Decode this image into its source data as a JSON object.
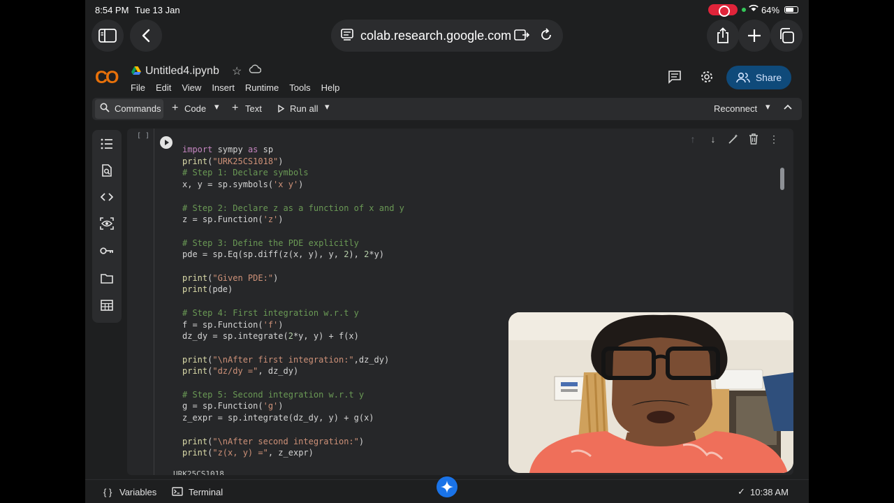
{
  "status": {
    "time": "8:54 PM",
    "date": "Tue 13 Jan",
    "battery": "64%"
  },
  "browser": {
    "url": "colab.research.google.com"
  },
  "colab": {
    "logo": "CO",
    "title": "Untitled4.ipynb",
    "menu": [
      "File",
      "Edit",
      "View",
      "Insert",
      "Runtime",
      "Tools",
      "Help"
    ],
    "share_label": "Share"
  },
  "toolbar": {
    "commands": "Commands",
    "code": "Code",
    "text": "Text",
    "run_all": "Run all",
    "reconnect": "Reconnect"
  },
  "cell": {
    "bracket": "[ ]",
    "lines": [
      "import sympy as sp",
      "print(\"URK25CS1018\")",
      "# Step 1: Declare symbols",
      "x, y = sp.symbols('x y')",
      "",
      "# Step 2: Declare z as a function of x and y",
      "z = sp.Function('z')",
      "",
      "# Step 3: Define the PDE explicitly",
      "pde = sp.Eq(sp.diff(z(x, y), y, 2), 2*y)",
      "",
      "print(\"Given PDE:\")",
      "print(pde)",
      "",
      "# Step 4: First integration w.r.t y",
      "f = sp.Function('f')",
      "dz_dy = sp.integrate(2*y, y) + f(x)",
      "",
      "print(\"\\nAfter first integration:\",dz_dy)",
      "print(\"dz/dy =\", dz_dy)",
      "",
      "# Step 5: Second integration w.r.t y",
      "g = sp.Function('g')",
      "z_expr = sp.integrate(dz_dy, y) + g(x)",
      "",
      "print(\"\\nAfter second integration:\")",
      "print(\"z(x, y) =\", z_expr)"
    ],
    "output_peek": "URK25CS1018"
  },
  "bottom": {
    "variables": "Variables",
    "terminal": "Terminal",
    "time": "10:38 AM"
  }
}
